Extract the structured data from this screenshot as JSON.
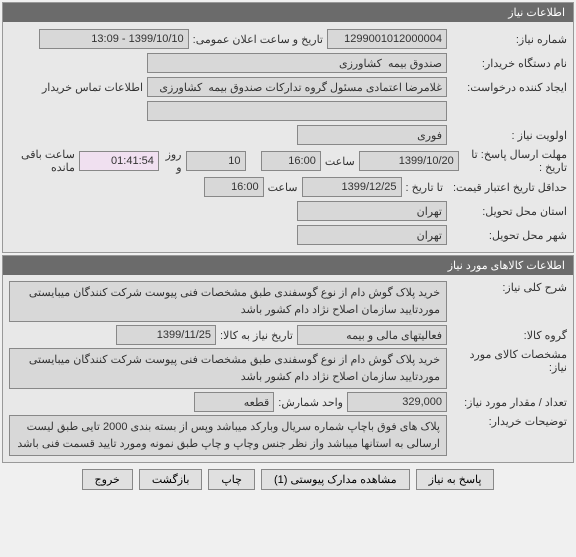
{
  "panel1": {
    "title": "اطلاعات نیاز",
    "need_no_label": "شماره نیاز:",
    "need_no": "1299001012000004",
    "announce_label": "تاریخ و ساعت اعلان عمومی:",
    "announce_value": "1399/10/10 - 13:09",
    "org_label": "نام دستگاه خریدار:",
    "org_value": "صندوق بیمه  کشاورزی",
    "creator_label": "ایجاد کننده درخواست:",
    "creator_value": "غلامرضا اعتمادی مسئول گروه تدارکات صندوق بیمه  کشاورزی",
    "contact_label": "اطلاعات تماس خریدار",
    "contact_value": "",
    "priority_label": "اولویت نیاز :",
    "priority_value": "فوری",
    "deadline_label": "مهلت ارسال پاسخ:  تا تاریخ :",
    "deadline_date": "1399/10/20",
    "time_label": "ساعت",
    "deadline_time": "16:00",
    "days_value": "10",
    "days_label": "روز و",
    "remaining_time": "01:41:54",
    "remaining_label": "ساعت باقی مانده",
    "min_valid_label": "حداقل تاریخ اعتبار قیمت:",
    "min_valid_until": "تا تاریخ :",
    "min_valid_date": "1399/12/25",
    "min_valid_time": "16:00",
    "delivery_prov_label": "استان محل تحویل:",
    "delivery_prov": "تهران",
    "delivery_city_label": "شهر محل تحویل:",
    "delivery_city": "تهران"
  },
  "panel2": {
    "title": "اطلاعات کالاهای مورد نیاز",
    "subject_label": "شرح کلی نیاز:",
    "subject_value": "خرید پلاک گوش دام از نوع گوسفندی طبق مشخصات فنی پیوست شرکت کنندگان میبایستی موردتایید سازمان اصلاح نژاد دام کشور باشد",
    "group_label": "گروه کالا:",
    "group_value": "فعالیتهای مالی و بیمه",
    "until_date_label": "تاریخ نیاز به کالا:",
    "until_date": "1399/11/25",
    "spec_label": "مشخصات کالای مورد نیاز:",
    "spec_value": "خرید پلاک گوش دام از نوع گوسفندی طبق مشخصات فنی پیوست شرکت کنندگان میبایستی موردتایید سازمان اصلاح نژاد دام کشور باشد",
    "qty_label": "تعداد / مقدار مورد نیاز:",
    "qty_value": "329,000",
    "unit_label": "واحد شمارش:",
    "unit_value": "قطعه",
    "notes_label": "توضیحات خریدار:",
    "notes_value": "پلاک های فوق باچاپ شماره سریال وبارکد میباشد وپس از بسته بندی 2000 تایی طبق لیست ارسالی به استانها میباشد واز نظر جنس وچاپ و چاپ طبق نمونه ومورد تایید قسمت فنی باشد"
  },
  "actions": {
    "respond": "پاسخ به نیاز",
    "attachments": "مشاهده مدارک پیوستی (1)",
    "print": "چاپ",
    "back": "بازگشت",
    "exit": "خروج"
  }
}
